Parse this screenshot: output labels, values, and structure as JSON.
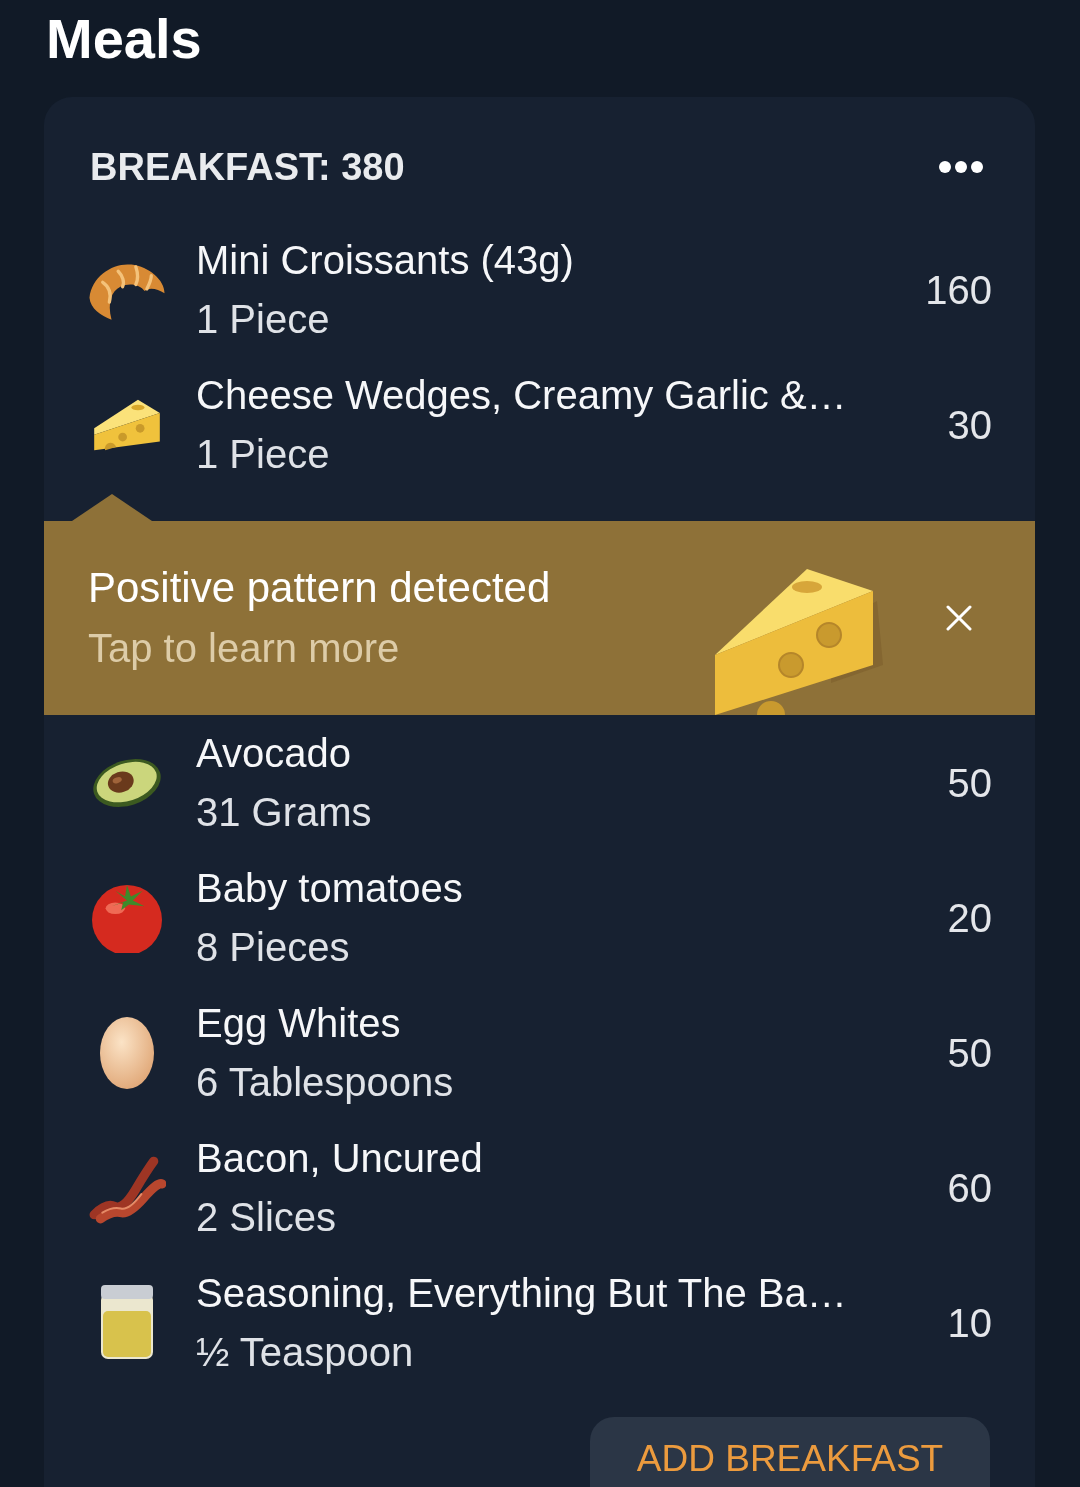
{
  "title": "Meals",
  "meal": {
    "header": "BREAKFAST: 380",
    "rows": [
      {
        "kind": "food",
        "name": "Mini Croissants (43g)",
        "serving": "1 Piece",
        "calories": "160"
      },
      {
        "kind": "food",
        "name": "Cheese Wedges, Creamy Garlic &…",
        "serving": "1 Piece",
        "calories": "30"
      },
      {
        "kind": "insight",
        "title": "Positive pattern detected",
        "subtitle": "Tap to learn more"
      },
      {
        "kind": "food",
        "name": "Avocado",
        "serving": "31 Grams",
        "calories": "50"
      },
      {
        "kind": "food",
        "name": "Baby tomatoes",
        "serving": "8 Pieces",
        "calories": "20"
      },
      {
        "kind": "food",
        "name": "Egg Whites",
        "serving": "6 Tablespoons",
        "calories": "50"
      },
      {
        "kind": "food",
        "name": "Bacon, Uncured",
        "serving": "2 Slices",
        "calories": "60"
      },
      {
        "kind": "food",
        "name": "Seasoning, Everything But The Ba…",
        "serving": "½ Teaspoon",
        "calories": "10"
      }
    ],
    "add_button": "ADD BREAKFAST"
  }
}
